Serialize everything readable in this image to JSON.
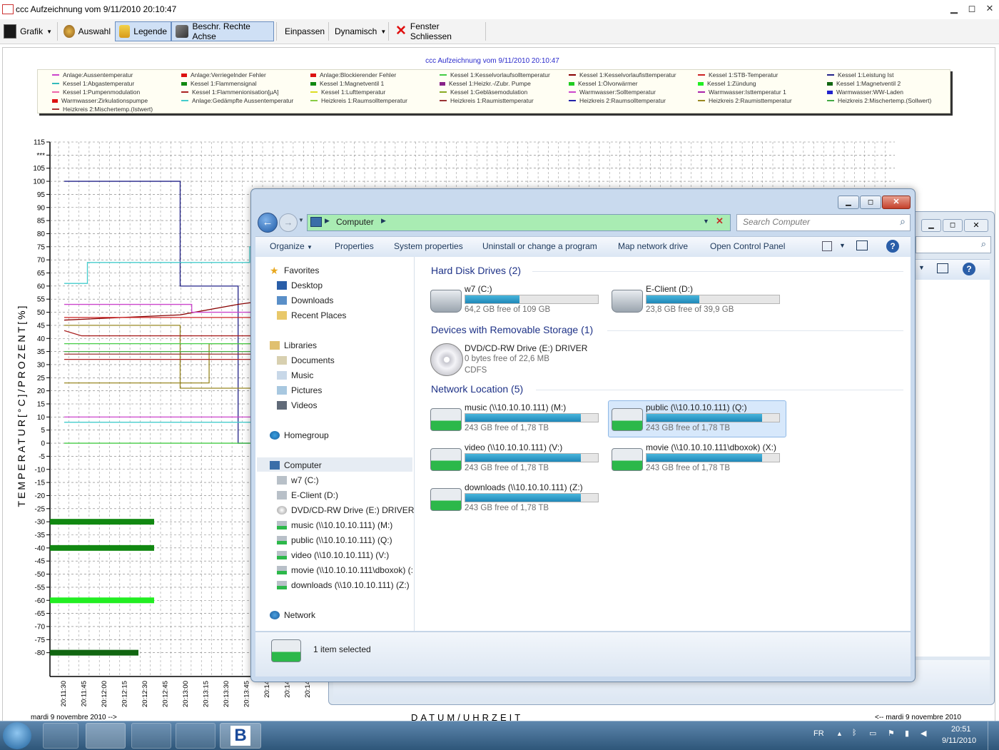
{
  "app": {
    "title": "ccc Aufzeichnung vom 9/11/2010 20:10:47",
    "toolbar": {
      "grafik": "Grafik",
      "auswahl": "Auswahl",
      "legende": "Legende",
      "beschr": "Beschr. Rechte Achse",
      "einpassen": "Einpassen",
      "dynamisch": "Dynamisch",
      "schliessen": "Fenster Schliessen"
    }
  },
  "chart_data": {
    "type": "line",
    "title": "ccc Aufzeichnung vom 9/11/2010 20:10:47",
    "ylabel": "TEMPERATUR[°C]/PROZENT[%]",
    "xlabel": "DATUM/UHRZEIT",
    "ylim": [
      -85,
      115
    ],
    "yticks": [
      "115",
      "***",
      "105",
      "100",
      "95",
      "90",
      "85",
      "80",
      "75",
      "70",
      "65",
      "60",
      "55",
      "50",
      "45",
      "40",
      "35",
      "30",
      "25",
      "20",
      "15",
      "10",
      "5",
      "0",
      "-5",
      "-10",
      "-15",
      "-20",
      "-25",
      "-30",
      "-35",
      "-40",
      "-45",
      "-50",
      "-55",
      "-60",
      "-65",
      "-70",
      "-75",
      "-80"
    ],
    "xticks": [
      "20:11:30",
      "20:11:45",
      "20:12:00",
      "20:12:15",
      "20:12:30",
      "20:12:45",
      "20:13:00",
      "20:13:15",
      "20:13:30",
      "20:13:45",
      "20:14",
      "20:14",
      "20:14"
    ],
    "date_left": "mardi 9 novembre 2010 -->",
    "date_right": "<-- mardi 9 novembre 2010",
    "legend": [
      {
        "name": "Anlage:Aussentemperatur",
        "color": "#cc44cc"
      },
      {
        "name": "Anlage:Verriegelnder Fehler",
        "color": "#dd1111",
        "box": true
      },
      {
        "name": "Anlage:Blockierender Fehler",
        "color": "#dd1111",
        "box": true
      },
      {
        "name": "Kessel 1:Kesselvorlaufsolltemperatur",
        "color": "#44cc44"
      },
      {
        "name": "Kessel 1:Kesselvorlaufisttemperatur",
        "color": "#880000"
      },
      {
        "name": "Kessel 1:STB-Temperatur",
        "color": "#cc2222"
      },
      {
        "name": "Kessel 1:Leistung Ist",
        "color": "#222288"
      },
      {
        "name": "Kessel 1:Abgastemperatur",
        "color": "#33bbbb"
      },
      {
        "name": "Kessel 1:Flammensignal",
        "color": "#118811",
        "box": true
      },
      {
        "name": "Kessel 1:Magnetventil 1",
        "color": "#118811",
        "box": true
      },
      {
        "name": "Kessel 1:Heizkr.-/Zubr. Pumpe",
        "color": "#882288",
        "box": true
      },
      {
        "name": "Kessel 1:Ölvorwärmer",
        "color": "#22cc22",
        "box": true
      },
      {
        "name": "Kessel 1:Zündung",
        "color": "#22ee22",
        "box": true
      },
      {
        "name": "Kessel 1:Magnetventil 2",
        "color": "#116611",
        "box": true
      },
      {
        "name": "Kessel 1:Pumpenmodulation",
        "color": "#ee66aa"
      },
      {
        "name": "Kessel 1:Flammenionisation[µA]",
        "color": "#aa2222"
      },
      {
        "name": "Kessel 1:Lufttemperatur",
        "color": "#dddd22"
      },
      {
        "name": "Kessel 1:Gebläsemodulation",
        "color": "#88aa22"
      },
      {
        "name": "Warmwasser:Solltemperatur",
        "color": "#cc44cc"
      },
      {
        "name": "Warmwasser:Isttemperatur 1",
        "color": "#aa22aa"
      },
      {
        "name": "Warmwasser:WW-Laden",
        "color": "#2222cc",
        "box": true
      },
      {
        "name": "Warmwasser:Zirkulationspumpe",
        "color": "#dd1111",
        "box": true
      },
      {
        "name": "Anlage:Gedämpfte Aussentemperatur",
        "color": "#44cccc"
      },
      {
        "name": "Heizkreis 1:Raumsolltemperatur",
        "color": "#88cc44"
      },
      {
        "name": "Heizkreis 1:Raumisttemperatur",
        "color": "#993333"
      },
      {
        "name": "Heizkreis 2:Raumsolltemperatur",
        "color": "#2222aa"
      },
      {
        "name": "Heizkreis 2:Raumisttemperatur",
        "color": "#998822"
      },
      {
        "name": "Heizkreis 2:Mischertemp.(Sollwert)",
        "color": "#44aa44"
      },
      {
        "name": "Heizkreis 2:Mischertemp.(Istwert)",
        "color": "#aa3333"
      }
    ],
    "series": [
      {
        "color": "#222288",
        "points": [
          [
            0,
            100
          ],
          [
            2,
            100
          ],
          [
            2,
            60
          ],
          [
            3,
            60
          ],
          [
            3,
            0
          ],
          [
            3.2,
            0
          ]
        ]
      },
      {
        "color": "#44cccc",
        "points": [
          [
            0,
            61
          ],
          [
            0.4,
            61
          ],
          [
            0.4,
            69
          ],
          [
            3.2,
            69
          ],
          [
            3.2,
            75
          ],
          [
            5.8,
            75
          ],
          [
            5.8,
            68
          ],
          [
            6,
            68
          ]
        ]
      },
      {
        "color": "#880000",
        "points": [
          [
            0,
            47
          ],
          [
            1,
            48
          ],
          [
            2,
            49
          ],
          [
            3,
            53
          ],
          [
            4,
            56
          ],
          [
            5,
            58
          ],
          [
            6,
            59
          ]
        ]
      },
      {
        "color": "#cc2222",
        "points": [
          [
            0,
            48
          ],
          [
            3.5,
            48
          ],
          [
            3.5,
            52
          ],
          [
            5.8,
            52
          ],
          [
            5.8,
            59
          ],
          [
            6,
            59
          ]
        ]
      },
      {
        "color": "#cc44cc",
        "points": [
          [
            0,
            53
          ],
          [
            2.2,
            53
          ],
          [
            2.2,
            50
          ],
          [
            6,
            50
          ]
        ]
      },
      {
        "color": "#cc44cc",
        "points": [
          [
            0,
            10
          ],
          [
            6,
            10
          ]
        ]
      },
      {
        "color": "#998822",
        "points": [
          [
            0,
            45
          ],
          [
            2,
            45
          ],
          [
            2,
            21
          ],
          [
            6,
            21
          ]
        ]
      },
      {
        "color": "#998822",
        "points": [
          [
            0,
            23
          ],
          [
            2.5,
            23
          ],
          [
            2.5,
            38
          ],
          [
            5,
            38
          ],
          [
            5,
            33
          ],
          [
            6,
            33
          ]
        ]
      },
      {
        "color": "#44cc44",
        "points": [
          [
            0,
            38
          ],
          [
            6,
            38
          ]
        ]
      },
      {
        "color": "#44aa44",
        "points": [
          [
            0,
            35
          ],
          [
            6,
            35
          ]
        ]
      },
      {
        "color": "#993333",
        "points": [
          [
            0,
            34
          ],
          [
            6,
            34
          ]
        ]
      },
      {
        "color": "#aa2222",
        "points": [
          [
            0,
            32
          ],
          [
            6,
            32
          ]
        ]
      },
      {
        "color": "#44cc44",
        "points": [
          [
            0,
            0
          ],
          [
            6,
            0
          ]
        ]
      },
      {
        "color": "#44cccc",
        "points": [
          [
            0,
            8
          ],
          [
            6,
            8
          ]
        ]
      },
      {
        "color": "#aa2222",
        "points": [
          [
            0,
            43
          ],
          [
            0.3,
            41
          ],
          [
            6,
            41
          ]
        ]
      }
    ],
    "bars": [
      {
        "y": -30,
        "color": "#118811"
      },
      {
        "y": -40,
        "color": "#118811"
      },
      {
        "y": -60,
        "color": "#22ee22"
      },
      {
        "y": -80,
        "color": "#116611"
      }
    ]
  },
  "explorer": {
    "address": "Computer",
    "search_placeholder": "Search Computer",
    "commands": [
      "Organize",
      "Properties",
      "System properties",
      "Uninstall or change a program",
      "Map network drive",
      "Open Control Panel"
    ],
    "nav": {
      "favorites": "Favorites",
      "desktop": "Desktop",
      "downloads": "Downloads",
      "recent": "Recent Places",
      "libraries": "Libraries",
      "documents": "Documents",
      "music": "Music",
      "pictures": "Pictures",
      "videos": "Videos",
      "homegroup": "Homegroup",
      "computer": "Computer",
      "w7": "w7 (C:)",
      "eclient": "E-Client (D:)",
      "dvd": "DVD/CD-RW Drive (E:) DRIVER",
      "music_net": "music (\\\\10.10.10.111) (M:)",
      "public_net": "public (\\\\10.10.10.111) (Q:)",
      "video_net": "video (\\\\10.10.10.111) (V:)",
      "movie_net": "movie (\\\\10.10.10.111\\dboxok) (:",
      "downloads_net": "downloads (\\\\10.10.10.111) (Z:)",
      "network": "Network"
    },
    "groups": {
      "hdd": "Hard Disk Drives (2)",
      "removable": "Devices with Removable Storage (1)",
      "network": "Network Location (5)"
    },
    "drives": {
      "c": {
        "name": "w7 (C:)",
        "size": "64,2 GB free of 109 GB",
        "used": 0.41
      },
      "d": {
        "name": "E-Client (D:)",
        "size": "23,8 GB free of 39,9 GB",
        "used": 0.4
      },
      "e": {
        "name": "DVD/CD-RW Drive (E:) DRIVER",
        "size": "0 bytes free of 22,6 MB",
        "fs": "CDFS"
      },
      "m": {
        "name": "music (\\\\10.10.10.111) (M:)",
        "size": "243 GB free of 1,78 TB",
        "used": 0.87
      },
      "q": {
        "name": "public (\\\\10.10.10.111) (Q:)",
        "size": "243 GB free of 1,78 TB",
        "used": 0.87
      },
      "v": {
        "name": "video (\\\\10.10.10.111) (V:)",
        "size": "243 GB free of 1,78 TB",
        "used": 0.87
      },
      "x": {
        "name": "movie (\\\\10.10.10.111\\dboxok) (X:)",
        "size": "243 GB free of 1,78 TB",
        "used": 0.87
      },
      "z": {
        "name": "downloads (\\\\10.10.10.111) (Z:)",
        "size": "243 GB free of 1,78 TB",
        "used": 0.87
      }
    },
    "status": "1 item selected"
  },
  "taskbar": {
    "lang": "FR",
    "time": "20:51",
    "date": "9/11/2010"
  }
}
